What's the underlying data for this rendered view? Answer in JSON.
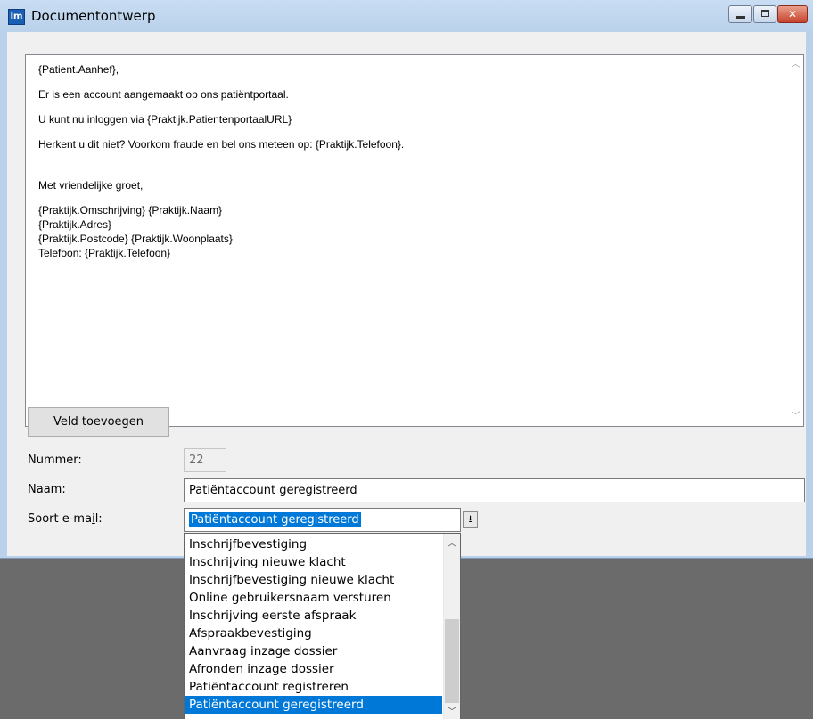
{
  "window": {
    "title": "Documentontwerp",
    "app_icon_text": "lm"
  },
  "editor": {
    "lines": [
      "{Patient.Aanhef},",
      "Er is een account aangemaakt op ons patiëntportaal.",
      "U kunt nu inloggen via {Praktijk.PatientenportaalURL}",
      "Herkent u dit niet? Voorkom fraude en bel ons meteen op: {Praktijk.Telefoon}.",
      "Met vriendelijke groet,",
      "{Praktijk.Omschrijving} {Praktijk.Naam}",
      "{Praktijk.Adres}",
      "{Praktijk.Postcode} {Praktijk.Woonplaats}",
      "Telefoon: {Praktijk.Telefoon}"
    ]
  },
  "buttons": {
    "add_field": "Veld toevoegen"
  },
  "form": {
    "number_label": "Nummer:",
    "number_value": "22",
    "name_label_pre": "Naa",
    "name_label_key": "m",
    "name_label_post": ":",
    "name_value": "Patiëntaccount geregistreerd",
    "type_label_pre": "Soort e-ma",
    "type_label_key": "i",
    "type_label_post": "l:",
    "type_value": "Patiëntaccount geregistreerd"
  },
  "dropdown": {
    "options": [
      "Inschrijfbevestiging",
      "Inschrijving nieuwe klacht",
      "Inschrijfbevestiging nieuwe klacht",
      "Online gebruikersnaam versturen",
      "Inschrijving eerste afspraak",
      "Afspraakbevestiging",
      "Aanvraag inzage dossier",
      "Afronden inzage dossier",
      "Patiëntaccount registreren",
      "Patiëntaccount geregistreerd"
    ],
    "selected_index": 9
  },
  "colors": {
    "selection": "#0078d7",
    "titlebar": "#b9d1ea",
    "desktop": "#6b6b6b"
  },
  "icons": {
    "app": "app-logo-icon",
    "minimize": "minimize-icon",
    "maximize": "maximize-icon",
    "close": "close-icon",
    "combo": "dropdown-arrow-icon"
  }
}
